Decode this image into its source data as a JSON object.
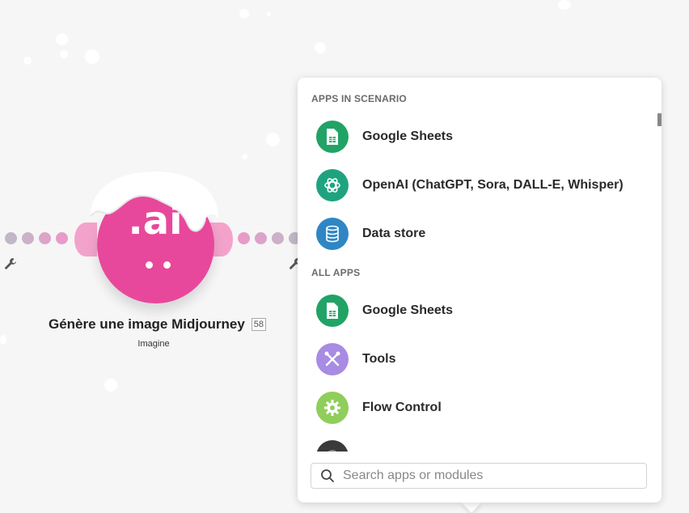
{
  "node": {
    "title": "Génère une image Midjourney",
    "id_badge": "58",
    "subtitle": "Imagine",
    "logo_text": ".ai",
    "color": "#e8489b"
  },
  "popup": {
    "sections": [
      {
        "label": "APPS IN SCENARIO",
        "apps": [
          {
            "label": "Google Sheets",
            "icon": "google-sheets-icon",
            "color": "#21a366"
          },
          {
            "label": "OpenAI (ChatGPT, Sora, DALL-E, Whisper)",
            "icon": "openai-icon",
            "color": "#1fa37f"
          },
          {
            "label": "Data store",
            "icon": "database-icon",
            "color": "#2f86c5"
          }
        ]
      },
      {
        "label": "ALL APPS",
        "apps": [
          {
            "label": "Google Sheets",
            "icon": "google-sheets-icon",
            "color": "#21a366"
          },
          {
            "label": "Tools",
            "icon": "tools-icon",
            "color": "#a88be3"
          },
          {
            "label": "Flow Control",
            "icon": "gear-icon",
            "color": "#8fce5b"
          }
        ]
      }
    ],
    "search": {
      "placeholder": "Search apps or modules",
      "value": ""
    }
  }
}
